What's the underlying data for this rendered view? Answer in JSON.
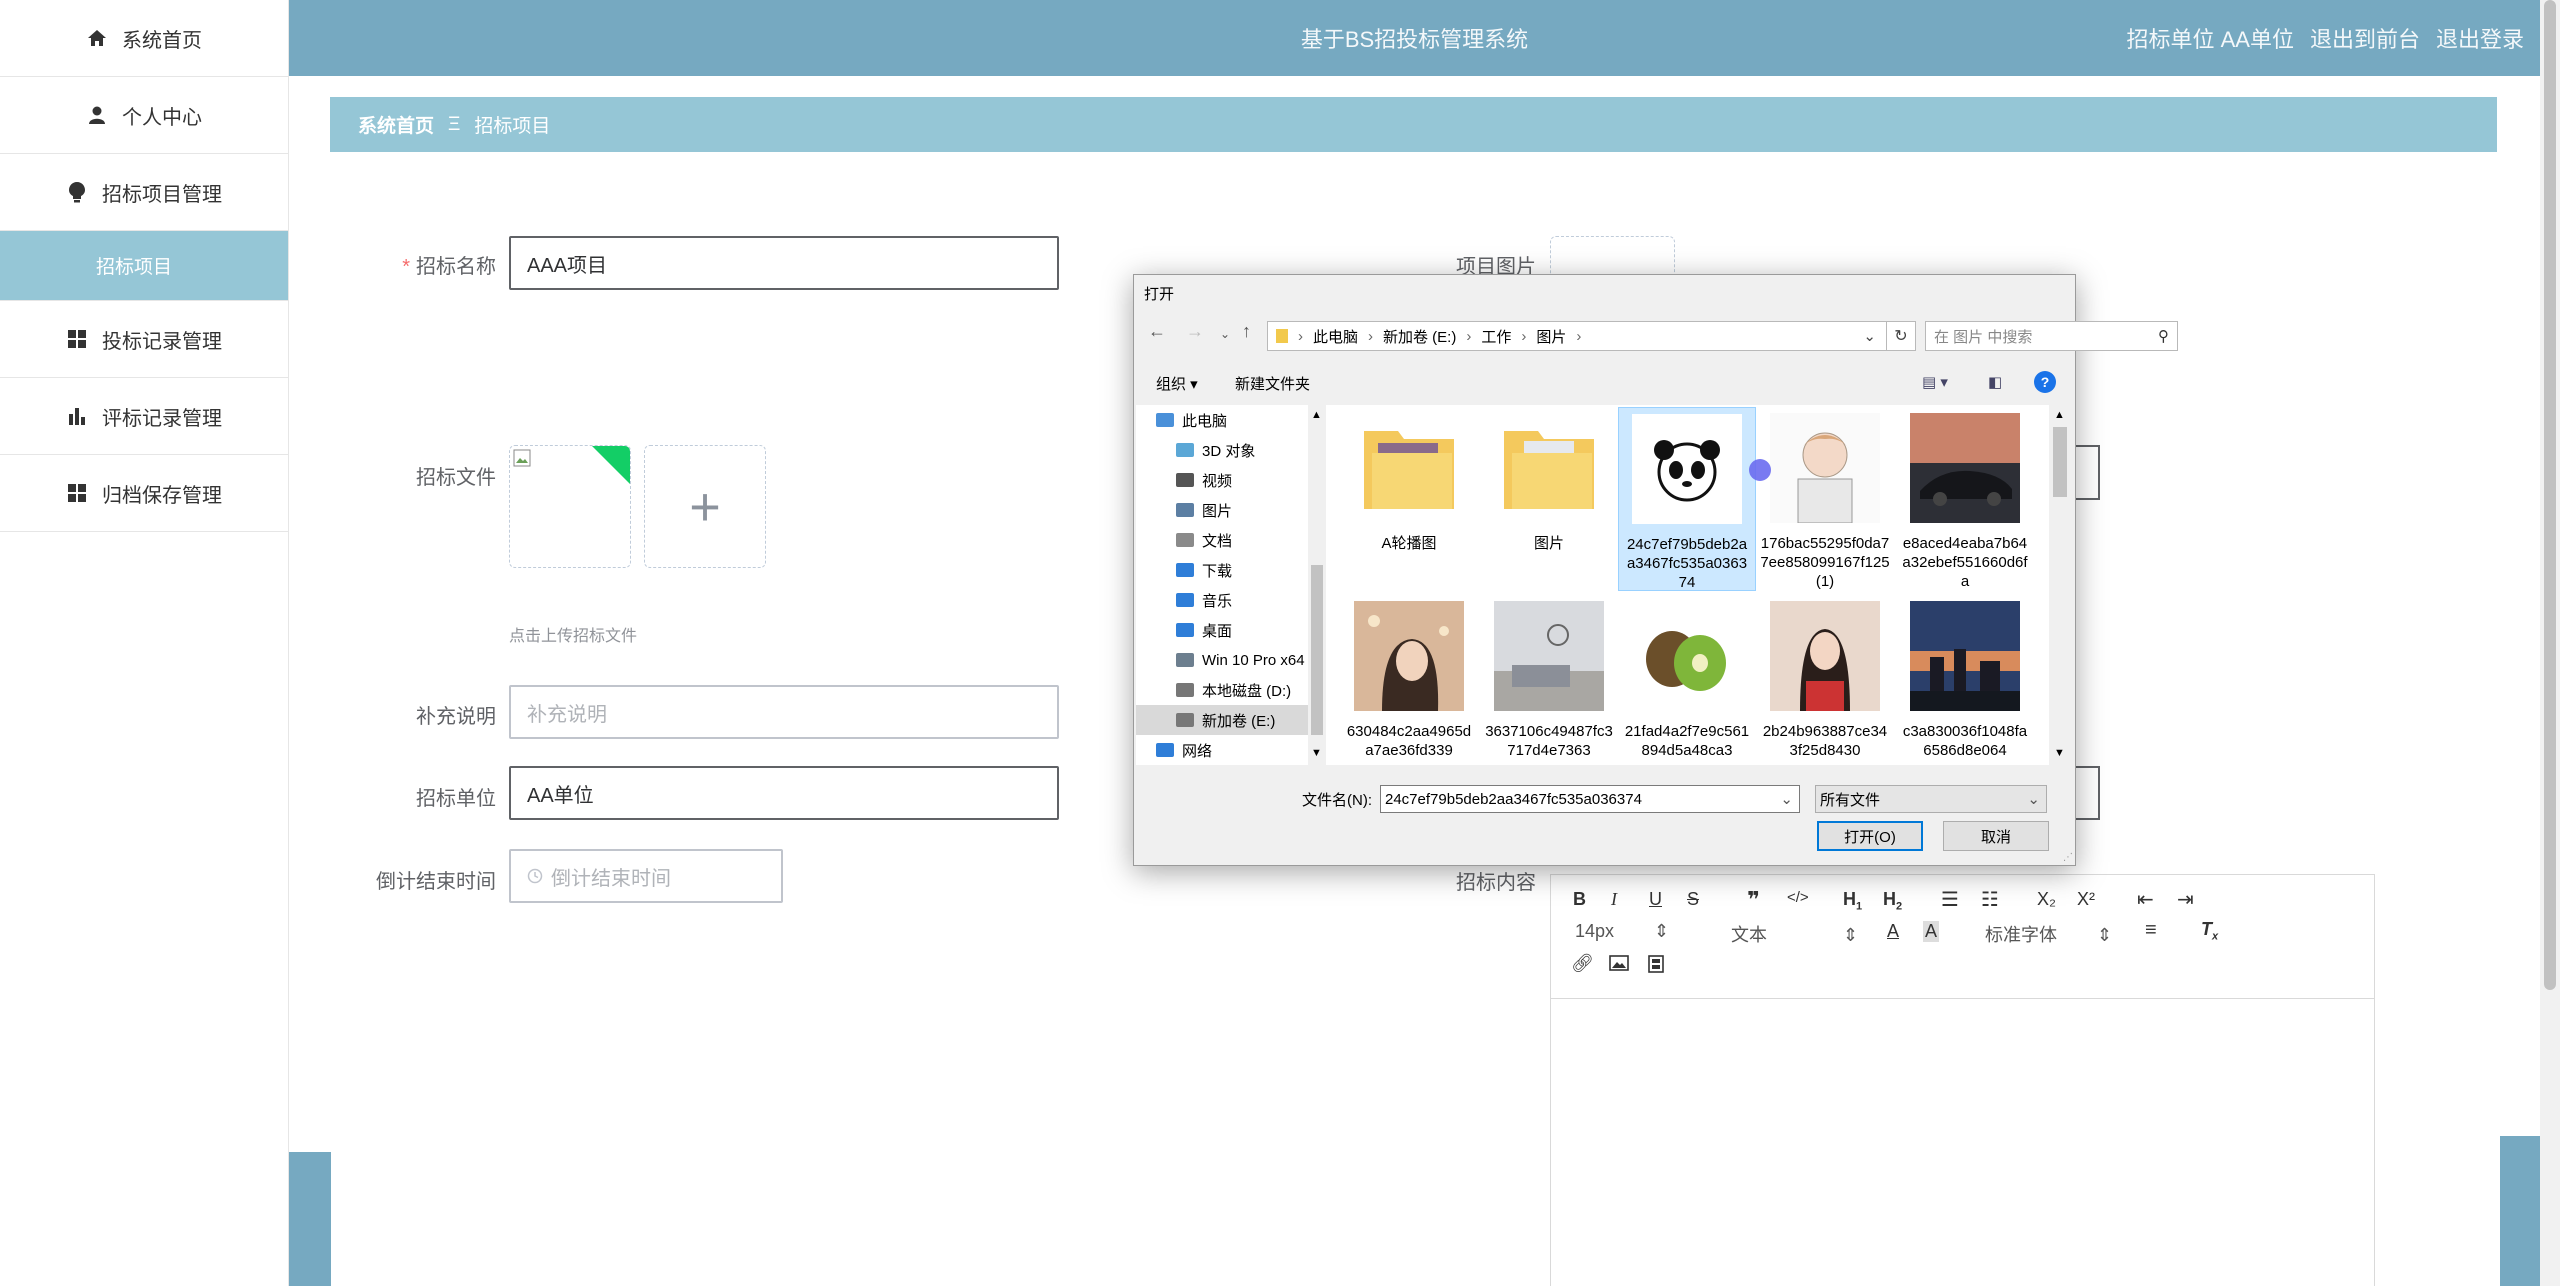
{
  "app": {
    "title": "基于BS招投标管理系统",
    "user_label": "招标单位 AA单位",
    "link_front": "退出到前台",
    "link_logout": "退出登录"
  },
  "sidebar": {
    "items": [
      {
        "label": "系统首页",
        "icon": "home-icon"
      },
      {
        "label": "个人中心",
        "icon": "user-icon"
      },
      {
        "label": "招标项目管理",
        "icon": "bulb-icon"
      },
      {
        "label": "招标项目",
        "icon": ""
      },
      {
        "label": "投标记录管理",
        "icon": "grid-icon"
      },
      {
        "label": "评标记录管理",
        "icon": "bar-chart-icon"
      },
      {
        "label": "归档保存管理",
        "icon": "grid-icon"
      }
    ]
  },
  "breadcrumb": {
    "home": "系统首页",
    "sep": "Ξ",
    "current": "招标项目"
  },
  "form": {
    "name_label": "招标名称",
    "name_required": "*",
    "name_value": "AAA项目",
    "file_label": "招标文件",
    "upload_hint": "点击上传招标文件",
    "note_label": "补充说明",
    "note_placeholder": "补充说明",
    "unit_label": "招标单位",
    "unit_value": "AA单位",
    "deadline_label": "倒计结束时间",
    "deadline_placeholder": "倒计结束时间",
    "image_label": "项目图片",
    "content_label": "招标内容",
    "plus": "+"
  },
  "editor": {
    "font_size": "14px",
    "text_style": "文本",
    "font_family": "标准字体",
    "sub": "X₂",
    "sup": "X²"
  },
  "dialog": {
    "title": "打开",
    "path": [
      "此电脑",
      "新加卷 (E:)",
      "工作",
      "图片"
    ],
    "search_placeholder": "在 图片 中搜索",
    "organize": "组织 ▾",
    "new_folder": "新建文件夹",
    "tree": [
      {
        "label": "此电脑",
        "color": "#4a90d9"
      },
      {
        "label": "3D 对象",
        "color": "#5ba7d6"
      },
      {
        "label": "视频",
        "color": "#555555"
      },
      {
        "label": "图片",
        "color": "#5c7fa3"
      },
      {
        "label": "文档",
        "color": "#8a8a8a"
      },
      {
        "label": "下载",
        "color": "#2f7ed8"
      },
      {
        "label": "音乐",
        "color": "#2f7ed8"
      },
      {
        "label": "桌面",
        "color": "#2f7ed8"
      },
      {
        "label": "Win 10 Pro x64",
        "color": "#6d7f8f"
      },
      {
        "label": "本地磁盘 (D:)",
        "color": "#777777"
      },
      {
        "label": "新加卷 (E:)",
        "color": "#777777"
      },
      {
        "label": "网络",
        "color": "#2f7ed8"
      }
    ],
    "files": [
      {
        "name": "A轮播图",
        "kind": "folder"
      },
      {
        "name": "图片",
        "kind": "folder"
      },
      {
        "name": "24c7ef79b5deb2aa3467fc535a036374",
        "kind": "panda",
        "selected": true
      },
      {
        "name": "176bac55295f0da77ee858099167f125(1)",
        "kind": "sketch"
      },
      {
        "name": "e8aced4eaba7b64a32ebef551660d6fa",
        "kind": "car"
      },
      {
        "name": "630484c2aa4965da7ae36fd339",
        "kind": "girl1"
      },
      {
        "name": "3637106c49487fc3717d4e7363",
        "kind": "room"
      },
      {
        "name": "21fad4a2f7e9c561894d5a48ca3",
        "kind": "kiwi"
      },
      {
        "name": "2b24b963887ce343f25d8430",
        "kind": "girl2"
      },
      {
        "name": "c3a830036f1048fa6586d8e064",
        "kind": "city"
      }
    ],
    "filename_label": "文件名(N):",
    "filename_value": "24c7ef79b5deb2aa3467fc535a036374",
    "filter": "所有文件",
    "open_button": "打开(O)",
    "cancel_button": "取消"
  }
}
